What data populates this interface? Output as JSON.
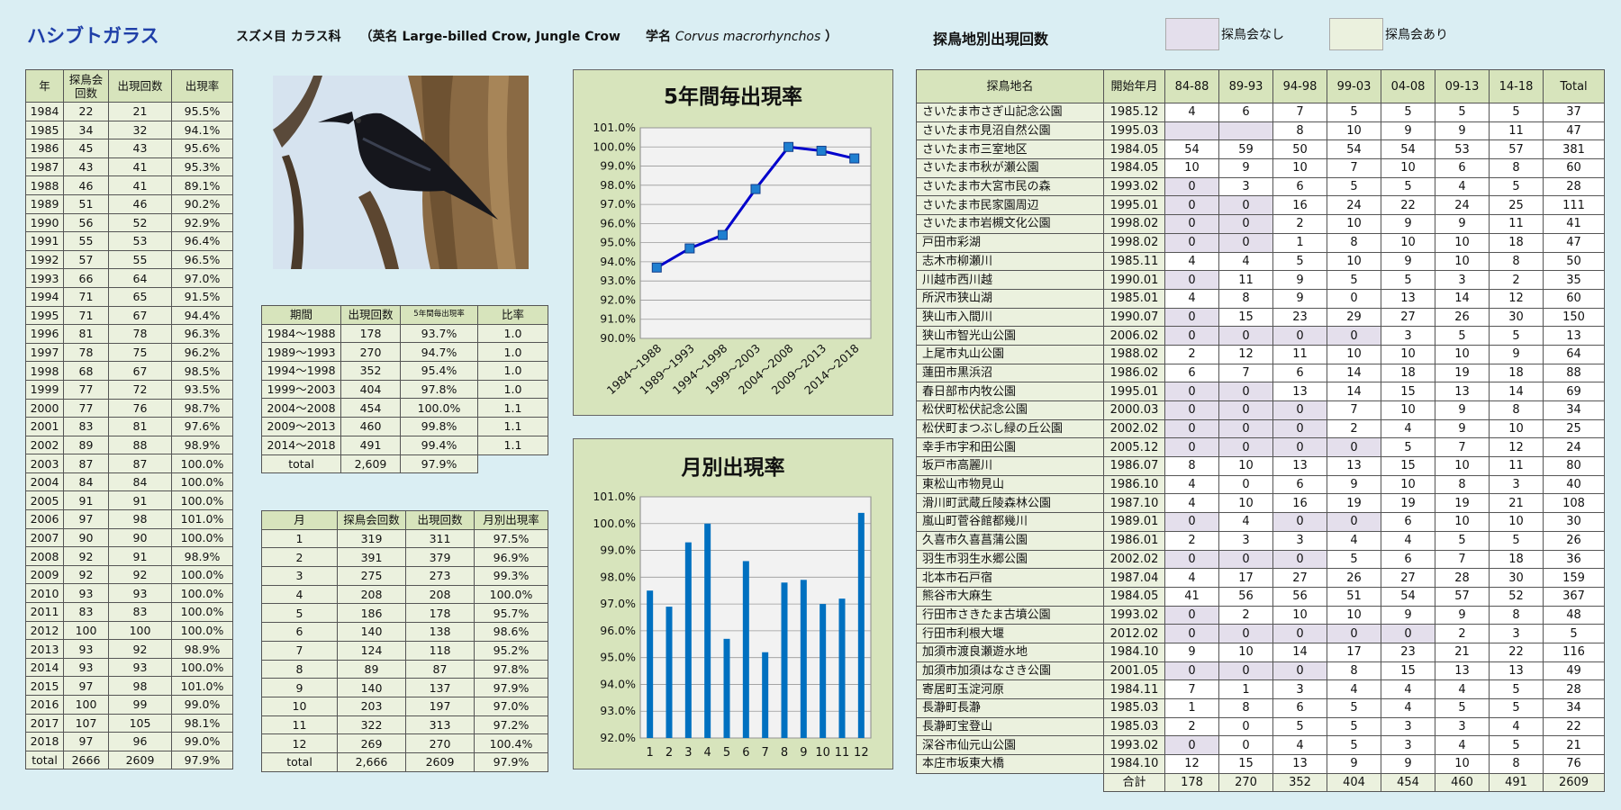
{
  "header": {
    "title": "ハシブトガラス",
    "order_family": "スズメ目 カラス科",
    "en_prefix": "（英名 Large-billed Crow, Jungle Crow",
    "sci_label": "学名",
    "sci_name": "Corvus macrorhynchos",
    "sci_close": "）",
    "sites_title": "探鳥地別出現回数",
    "legend_none": "探鳥会なし",
    "legend_held": "探鳥会あり",
    "colors": {
      "title": "#1f3fa8",
      "legend_none": "#e4dfec",
      "legend_held": "#ebf1de",
      "bar": "#0070c0",
      "line": "#0000cc",
      "marker": "#1f7fd0"
    }
  },
  "year_table": {
    "headers": [
      "年",
      "探鳥会回数",
      "出現回数",
      "出現率"
    ],
    "rows": [
      [
        "1984",
        "22",
        "21",
        "95.5%"
      ],
      [
        "1985",
        "34",
        "32",
        "94.1%"
      ],
      [
        "1986",
        "45",
        "43",
        "95.6%"
      ],
      [
        "1987",
        "43",
        "41",
        "95.3%"
      ],
      [
        "1988",
        "46",
        "41",
        "89.1%"
      ],
      [
        "1989",
        "51",
        "46",
        "90.2%"
      ],
      [
        "1990",
        "56",
        "52",
        "92.9%"
      ],
      [
        "1991",
        "55",
        "53",
        "96.4%"
      ],
      [
        "1992",
        "57",
        "55",
        "96.5%"
      ],
      [
        "1993",
        "66",
        "64",
        "97.0%"
      ],
      [
        "1994",
        "71",
        "65",
        "91.5%"
      ],
      [
        "1995",
        "71",
        "67",
        "94.4%"
      ],
      [
        "1996",
        "81",
        "78",
        "96.3%"
      ],
      [
        "1997",
        "78",
        "75",
        "96.2%"
      ],
      [
        "1998",
        "68",
        "67",
        "98.5%"
      ],
      [
        "1999",
        "77",
        "72",
        "93.5%"
      ],
      [
        "2000",
        "77",
        "76",
        "98.7%"
      ],
      [
        "2001",
        "83",
        "81",
        "97.6%"
      ],
      [
        "2002",
        "89",
        "88",
        "98.9%"
      ],
      [
        "2003",
        "87",
        "87",
        "100.0%"
      ],
      [
        "2004",
        "84",
        "84",
        "100.0%"
      ],
      [
        "2005",
        "91",
        "91",
        "100.0%"
      ],
      [
        "2006",
        "97",
        "98",
        "101.0%"
      ],
      [
        "2007",
        "90",
        "90",
        "100.0%"
      ],
      [
        "2008",
        "92",
        "91",
        "98.9%"
      ],
      [
        "2009",
        "92",
        "92",
        "100.0%"
      ],
      [
        "2010",
        "93",
        "93",
        "100.0%"
      ],
      [
        "2011",
        "83",
        "83",
        "100.0%"
      ],
      [
        "2012",
        "100",
        "100",
        "100.0%"
      ],
      [
        "2013",
        "93",
        "92",
        "98.9%"
      ],
      [
        "2014",
        "93",
        "93",
        "100.0%"
      ],
      [
        "2015",
        "97",
        "98",
        "101.0%"
      ],
      [
        "2016",
        "100",
        "99",
        "99.0%"
      ],
      [
        "2017",
        "107",
        "105",
        "98.1%"
      ],
      [
        "2018",
        "97",
        "96",
        "99.0%"
      ]
    ],
    "total": [
      "total",
      "2666",
      "2609",
      "97.9%"
    ]
  },
  "period_table": {
    "headers": [
      "期間",
      "出現回数",
      "5年間毎出現率",
      "比率"
    ],
    "rows": [
      [
        "1984～1988",
        "178",
        "93.7%",
        "1.0"
      ],
      [
        "1989～1993",
        "270",
        "94.7%",
        "1.0"
      ],
      [
        "1994～1998",
        "352",
        "95.4%",
        "1.0"
      ],
      [
        "1999～2003",
        "404",
        "97.8%",
        "1.0"
      ],
      [
        "2004～2008",
        "454",
        "100.0%",
        "1.1"
      ],
      [
        "2009～2013",
        "460",
        "99.8%",
        "1.1"
      ],
      [
        "2014～2018",
        "491",
        "99.4%",
        "1.1"
      ]
    ],
    "total": [
      "total",
      "2,609",
      "97.9%"
    ]
  },
  "month_table": {
    "headers": [
      "月",
      "探鳥会回数",
      "出現回数",
      "月別出現率"
    ],
    "rows": [
      [
        "1",
        "319",
        "311",
        "97.5%"
      ],
      [
        "2",
        "391",
        "379",
        "96.9%"
      ],
      [
        "3",
        "275",
        "273",
        "99.3%"
      ],
      [
        "4",
        "208",
        "208",
        "100.0%"
      ],
      [
        "5",
        "186",
        "178",
        "95.7%"
      ],
      [
        "6",
        "140",
        "138",
        "98.6%"
      ],
      [
        "7",
        "124",
        "118",
        "95.2%"
      ],
      [
        "8",
        "89",
        "87",
        "97.8%"
      ],
      [
        "9",
        "140",
        "137",
        "97.9%"
      ],
      [
        "10",
        "203",
        "197",
        "97.0%"
      ],
      [
        "11",
        "322",
        "313",
        "97.2%"
      ],
      [
        "12",
        "269",
        "270",
        "100.4%"
      ]
    ],
    "total": [
      "total",
      "2,666",
      "2609",
      "97.9%"
    ]
  },
  "site_table": {
    "headers": [
      "探鳥地名",
      "開始年月",
      "84-88",
      "89-93",
      "94-98",
      "99-03",
      "04-08",
      "09-13",
      "14-18",
      "Total"
    ],
    "rows": [
      {
        "name": "さいたま市さぎ山記念公園",
        "start": "1985.12",
        "vals": [
          "4",
          "6",
          "7",
          "5",
          "5",
          "5",
          "5"
        ],
        "total": "37",
        "none": []
      },
      {
        "name": "さいたま市見沼自然公園",
        "start": "1995.03",
        "vals": [
          "",
          "",
          "8",
          "10",
          "9",
          "9",
          "11"
        ],
        "total": "47",
        "none": [
          0,
          1
        ]
      },
      {
        "name": "さいたま市三室地区",
        "start": "1984.05",
        "vals": [
          "54",
          "59",
          "50",
          "54",
          "54",
          "53",
          "57"
        ],
        "total": "381",
        "none": []
      },
      {
        "name": "さいたま市秋が瀬公園",
        "start": "1984.05",
        "vals": [
          "10",
          "9",
          "10",
          "7",
          "10",
          "6",
          "8"
        ],
        "total": "60",
        "none": []
      },
      {
        "name": "さいたま市大宮市民の森",
        "start": "1993.02",
        "vals": [
          "0",
          "3",
          "6",
          "5",
          "5",
          "4",
          "5"
        ],
        "total": "28",
        "none": [
          0
        ]
      },
      {
        "name": "さいたま市民家園周辺",
        "start": "1995.01",
        "vals": [
          "0",
          "0",
          "16",
          "24",
          "22",
          "24",
          "25"
        ],
        "total": "111",
        "none": [
          0,
          1
        ]
      },
      {
        "name": "さいたま市岩槻文化公園",
        "start": "1998.02",
        "vals": [
          "0",
          "0",
          "2",
          "10",
          "9",
          "9",
          "11"
        ],
        "total": "41",
        "none": [
          0,
          1
        ]
      },
      {
        "name": "戸田市彩湖",
        "start": "1998.02",
        "vals": [
          "0",
          "0",
          "1",
          "8",
          "10",
          "10",
          "18"
        ],
        "total": "47",
        "none": [
          0,
          1
        ]
      },
      {
        "name": "志木市柳瀬川",
        "start": "1985.11",
        "vals": [
          "4",
          "4",
          "5",
          "10",
          "9",
          "10",
          "8"
        ],
        "total": "50",
        "none": []
      },
      {
        "name": "川越市西川越",
        "start": "1990.01",
        "vals": [
          "0",
          "11",
          "9",
          "5",
          "5",
          "3",
          "2"
        ],
        "total": "35",
        "none": [
          0
        ]
      },
      {
        "name": "所沢市狭山湖",
        "start": "1985.01",
        "vals": [
          "4",
          "8",
          "9",
          "0",
          "13",
          "14",
          "12"
        ],
        "total": "60",
        "none": []
      },
      {
        "name": "狭山市入間川",
        "start": "1990.07",
        "vals": [
          "0",
          "15",
          "23",
          "29",
          "27",
          "26",
          "30"
        ],
        "total": "150",
        "none": [
          0
        ]
      },
      {
        "name": "狭山市智光山公園",
        "start": "2006.02",
        "vals": [
          "0",
          "0",
          "0",
          "0",
          "3",
          "5",
          "5"
        ],
        "total": "13",
        "none": [
          0,
          1,
          2,
          3
        ]
      },
      {
        "name": "上尾市丸山公園",
        "start": "1988.02",
        "vals": [
          "2",
          "12",
          "11",
          "10",
          "10",
          "10",
          "9"
        ],
        "total": "64",
        "none": []
      },
      {
        "name": "蓮田市黒浜沼",
        "start": "1986.02",
        "vals": [
          "6",
          "7",
          "6",
          "14",
          "18",
          "19",
          "18"
        ],
        "total": "88",
        "none": []
      },
      {
        "name": "春日部市内牧公園",
        "start": "1995.01",
        "vals": [
          "0",
          "0",
          "13",
          "14",
          "15",
          "13",
          "14"
        ],
        "total": "69",
        "none": [
          0,
          1
        ]
      },
      {
        "name": "松伏町松伏記念公園",
        "start": "2000.03",
        "vals": [
          "0",
          "0",
          "0",
          "7",
          "10",
          "9",
          "8"
        ],
        "total": "34",
        "none": [
          0,
          1,
          2
        ]
      },
      {
        "name": "松伏町まつぶし緑の丘公園",
        "start": "2002.02",
        "vals": [
          "0",
          "0",
          "0",
          "2",
          "4",
          "9",
          "10"
        ],
        "total": "25",
        "none": [
          0,
          1,
          2
        ]
      },
      {
        "name": "幸手市宇和田公園",
        "start": "2005.12",
        "vals": [
          "0",
          "0",
          "0",
          "0",
          "5",
          "7",
          "12"
        ],
        "total": "24",
        "none": [
          0,
          1,
          2,
          3
        ]
      },
      {
        "name": "坂戸市高麗川",
        "start": "1986.07",
        "vals": [
          "8",
          "10",
          "13",
          "13",
          "15",
          "10",
          "11"
        ],
        "total": "80",
        "none": []
      },
      {
        "name": "東松山市物見山",
        "start": "1986.10",
        "vals": [
          "4",
          "0",
          "6",
          "9",
          "10",
          "8",
          "3"
        ],
        "total": "40",
        "none": []
      },
      {
        "name": "滑川町武蔵丘陵森林公園",
        "start": "1987.10",
        "vals": [
          "4",
          "10",
          "16",
          "19",
          "19",
          "19",
          "21"
        ],
        "total": "108",
        "none": []
      },
      {
        "name": "嵐山町菅谷館都幾川",
        "start": "1989.01",
        "vals": [
          "0",
          "4",
          "0",
          "0",
          "6",
          "10",
          "10"
        ],
        "total": "30",
        "none": [
          0,
          2,
          3
        ]
      },
      {
        "name": "久喜市久喜菖蒲公園",
        "start": "1986.01",
        "vals": [
          "2",
          "3",
          "3",
          "4",
          "4",
          "5",
          "5"
        ],
        "total": "26",
        "none": []
      },
      {
        "name": "羽生市羽生水郷公園",
        "start": "2002.02",
        "vals": [
          "0",
          "0",
          "0",
          "5",
          "6",
          "7",
          "18"
        ],
        "total": "36",
        "none": [
          0,
          1,
          2
        ]
      },
      {
        "name": "北本市石戸宿",
        "start": "1987.04",
        "vals": [
          "4",
          "17",
          "27",
          "26",
          "27",
          "28",
          "30"
        ],
        "total": "159",
        "none": []
      },
      {
        "name": "熊谷市大麻生",
        "start": "1984.05",
        "vals": [
          "41",
          "56",
          "56",
          "51",
          "54",
          "57",
          "52"
        ],
        "total": "367",
        "none": []
      },
      {
        "name": "行田市さきたま古墳公園",
        "start": "1993.02",
        "vals": [
          "0",
          "2",
          "10",
          "10",
          "9",
          "9",
          "8"
        ],
        "total": "48",
        "none": [
          0
        ]
      },
      {
        "name": "行田市利根大堰",
        "start": "2012.02",
        "vals": [
          "0",
          "0",
          "0",
          "0",
          "0",
          "2",
          "3"
        ],
        "total": "5",
        "none": [
          0,
          1,
          2,
          3,
          4
        ]
      },
      {
        "name": "加須市渡良瀬遊水地",
        "start": "1984.10",
        "vals": [
          "9",
          "10",
          "14",
          "17",
          "23",
          "21",
          "22"
        ],
        "total": "116",
        "none": []
      },
      {
        "name": "加須市加須はなさき公園",
        "start": "2001.05",
        "vals": [
          "0",
          "0",
          "0",
          "8",
          "15",
          "13",
          "13"
        ],
        "total": "49",
        "none": [
          0,
          1,
          2
        ]
      },
      {
        "name": "寄居町玉淀河原",
        "start": "1984.11",
        "vals": [
          "7",
          "1",
          "3",
          "4",
          "4",
          "4",
          "5"
        ],
        "total": "28",
        "none": []
      },
      {
        "name": "長瀞町長瀞",
        "start": "1985.03",
        "vals": [
          "1",
          "8",
          "6",
          "5",
          "4",
          "5",
          "5"
        ],
        "total": "34",
        "none": []
      },
      {
        "name": "長瀞町宝登山",
        "start": "1985.03",
        "vals": [
          "2",
          "0",
          "5",
          "5",
          "3",
          "3",
          "4"
        ],
        "total": "22",
        "none": []
      },
      {
        "name": "深谷市仙元山公園",
        "start": "1993.02",
        "vals": [
          "0",
          "0",
          "4",
          "5",
          "3",
          "4",
          "5"
        ],
        "total": "21",
        "none": [
          0
        ]
      },
      {
        "name": "本庄市坂東大橋",
        "start": "1984.10",
        "vals": [
          "12",
          "15",
          "13",
          "9",
          "9",
          "10",
          "8"
        ],
        "total": "76",
        "none": []
      }
    ],
    "total_label": "合計",
    "totals": [
      "178",
      "270",
      "352",
      "404",
      "454",
      "460",
      "491",
      "2609"
    ]
  },
  "chart_data": [
    {
      "type": "line",
      "title": "5年間毎出現率",
      "categories": [
        "1984～1988",
        "1989～1993",
        "1994～1998",
        "1999～2003",
        "2004～2008",
        "2009～2013",
        "2014～2018"
      ],
      "values": [
        93.7,
        94.7,
        95.4,
        97.8,
        100.0,
        99.8,
        99.4
      ],
      "ylim": [
        90.0,
        101.0
      ],
      "ytick_step": 1.0,
      "grid": true,
      "unit": "%"
    },
    {
      "type": "bar",
      "title": "月別出現率",
      "categories": [
        "1",
        "2",
        "3",
        "4",
        "5",
        "6",
        "7",
        "8",
        "9",
        "10",
        "11",
        "12"
      ],
      "values": [
        97.5,
        96.9,
        99.3,
        100.0,
        95.7,
        98.6,
        95.2,
        97.8,
        97.9,
        97.0,
        97.2,
        100.4
      ],
      "ylim": [
        92.0,
        101.0
      ],
      "ytick_step": 1.0,
      "grid": true,
      "unit": "%"
    }
  ]
}
